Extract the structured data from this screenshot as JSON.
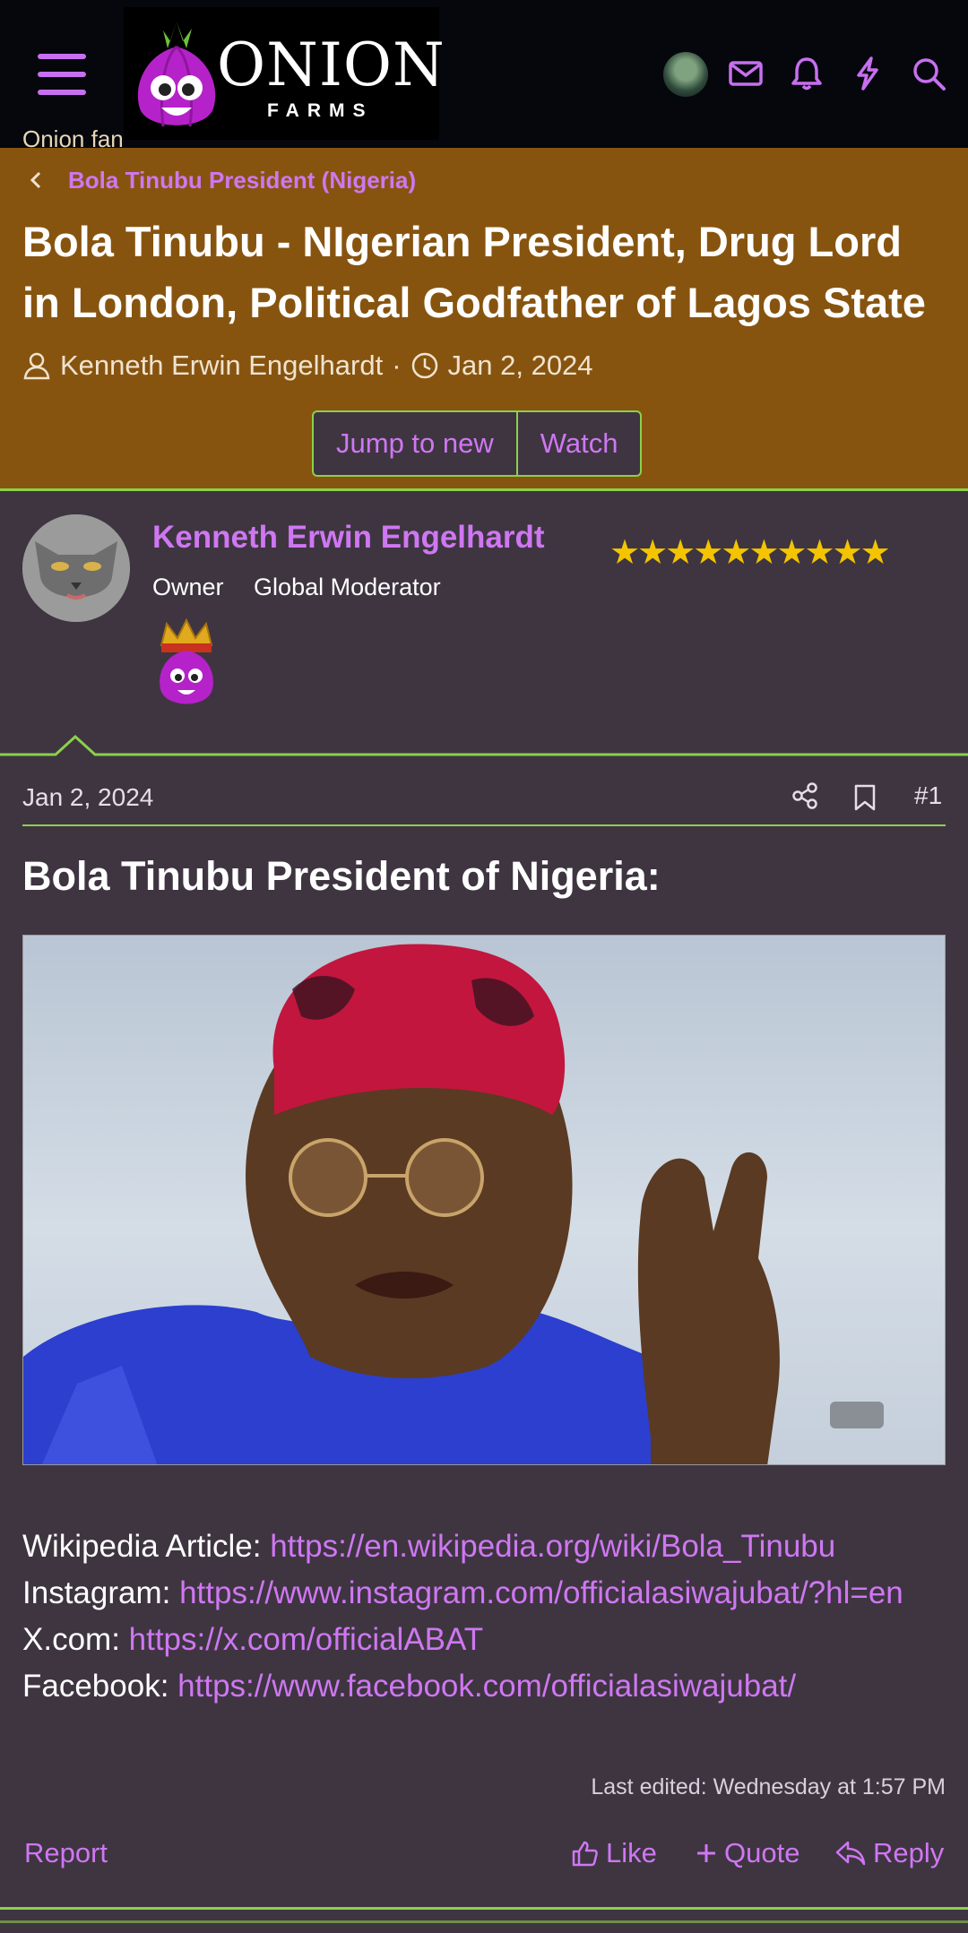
{
  "header": {
    "logo_word": "ONION",
    "logo_sub": "FARMS",
    "crumb_top": "Onion fan",
    "crumb": "Bola Tinubu President (Nigeria)"
  },
  "thread": {
    "title": "Bola Tinubu - NIgerian President, Drug Lord in London, Political Godfather of Lagos State",
    "author": "Kenneth Erwin Engelhardt",
    "separator": "·",
    "date": "Jan 2, 2024",
    "jump_label": "Jump to new",
    "watch_label": "Watch"
  },
  "post": {
    "username": "Kenneth Erwin Engelhardt",
    "role1": "Owner",
    "role2": "Global Moderator",
    "stars": "★★★★★★★★★★",
    "rating_stars": 10,
    "date": "Jan 2, 2024",
    "number": "#1",
    "heading": "Bola Tinubu President of Nigeria:",
    "links": [
      {
        "label": "Wikipedia Article: ",
        "url": "https://en.wikipedia.org/wiki/Bola_Tinubu"
      },
      {
        "label": "Instagram: ",
        "url": "https://www.instagram.com/officialasiwajubat/?hl=en"
      },
      {
        "label": "X.com: ",
        "url": "https://x.com/officialABAT"
      },
      {
        "label": "Facebook: ",
        "url": "https://www.facebook.com/officialasiwajubat/"
      }
    ],
    "edited": "Last edited: Wednesday at 1:57 PM",
    "report_label": "Report",
    "like_label": "Like",
    "quote_label": "Quote",
    "reply_label": "Reply"
  },
  "colors": {
    "accent": "#cf77f2",
    "header_bg": "#87540f",
    "body_bg": "#3e3541",
    "line": "#8bd14a",
    "topbar": "#05070c"
  }
}
